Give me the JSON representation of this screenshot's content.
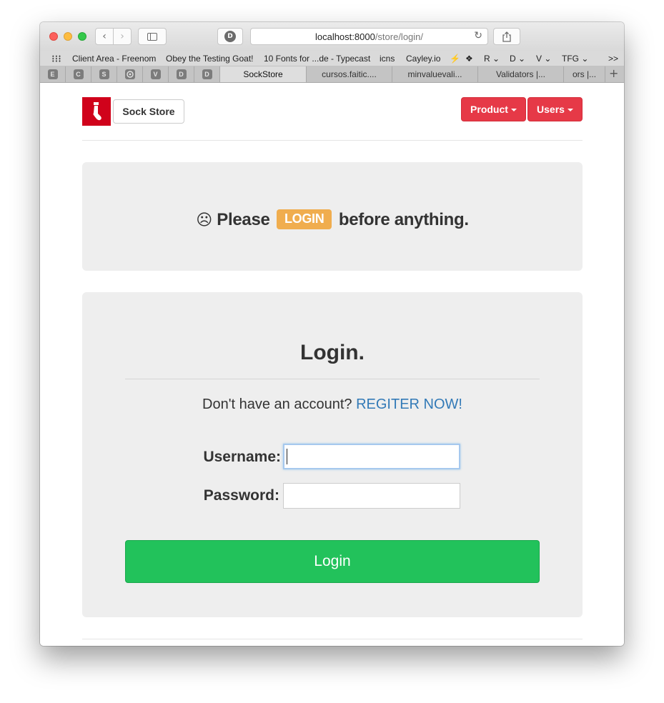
{
  "browser": {
    "url_host": "localhost:8000",
    "url_path": "/store/login/",
    "bookmarks": [
      "Client Area - Freenom",
      "Obey the Testing Goat!",
      "10 Fonts for ...de - Typecast",
      "icns",
      "Cayley.io",
      "⚡",
      "❖",
      "R ⌄",
      "D ⌄",
      "V ⌄",
      "TFG ⌄",
      ">>"
    ],
    "pinned_tabs": [
      "E",
      "C",
      "S",
      "",
      "V",
      "D",
      "D"
    ],
    "tabs": [
      "SockStore",
      "cursos.faitic....",
      "minvaluevali...",
      "Validators |...",
      "ors |..."
    ],
    "icons": {
      "back": "chevron-left-icon",
      "forward": "chevron-right-icon",
      "sidebar": "sidebar-icon",
      "privacy": "privacy-icon",
      "reload": "reload-icon",
      "share": "share-icon",
      "new_tab": "plus-icon"
    }
  },
  "navbar": {
    "brand": "Sock Store",
    "logo_icon": "stocking-icon",
    "menus": [
      "Product",
      "Users"
    ],
    "menu_color": "#e63947"
  },
  "alert": {
    "prefix": "Please",
    "label": "LOGIN",
    "suffix": "before anything.",
    "icon": "sad-face-icon",
    "label_color": "#f0ad4e"
  },
  "login": {
    "title": "Login.",
    "register_prompt": "Don't have an account?",
    "register_link": "REGITER NOW!",
    "username_label": "Username:",
    "password_label": "Password:",
    "username_value": "",
    "password_value": "",
    "submit_label": "Login",
    "submit_color": "#22c25b"
  }
}
